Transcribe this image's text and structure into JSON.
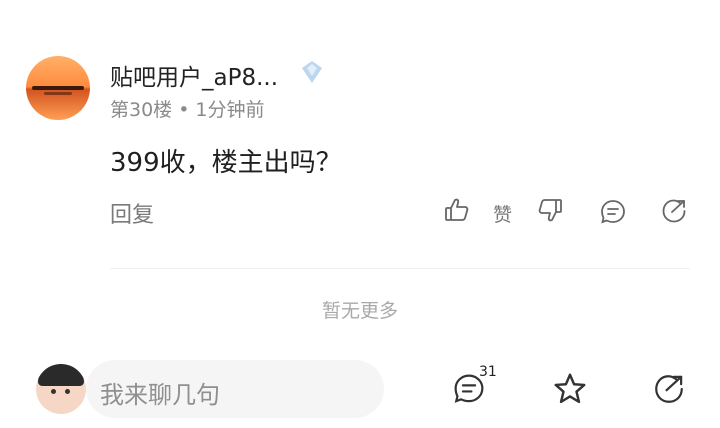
{
  "post": {
    "username": "贴吧用户_aP8...",
    "floor": "第30楼",
    "time": "1分钟前",
    "separator": "•",
    "content": "399收，楼主出吗？",
    "reply_label": "回复",
    "like_label": "赞"
  },
  "list": {
    "end_text": "暂无更多"
  },
  "bottom_bar": {
    "input_placeholder": "我来聊几句",
    "comment_count": "31"
  },
  "icons": {
    "badge": "diamond-badge-icon",
    "like": "thumbs-up-icon",
    "dislike": "thumbs-down-icon",
    "comment": "comment-bubble-icon",
    "share": "share-arrow-icon",
    "favorite": "star-icon"
  },
  "colors": {
    "text_primary": "#222222",
    "text_secondary": "#8a8a8a",
    "icon": "#666666",
    "badge": "#bcd6ee"
  }
}
